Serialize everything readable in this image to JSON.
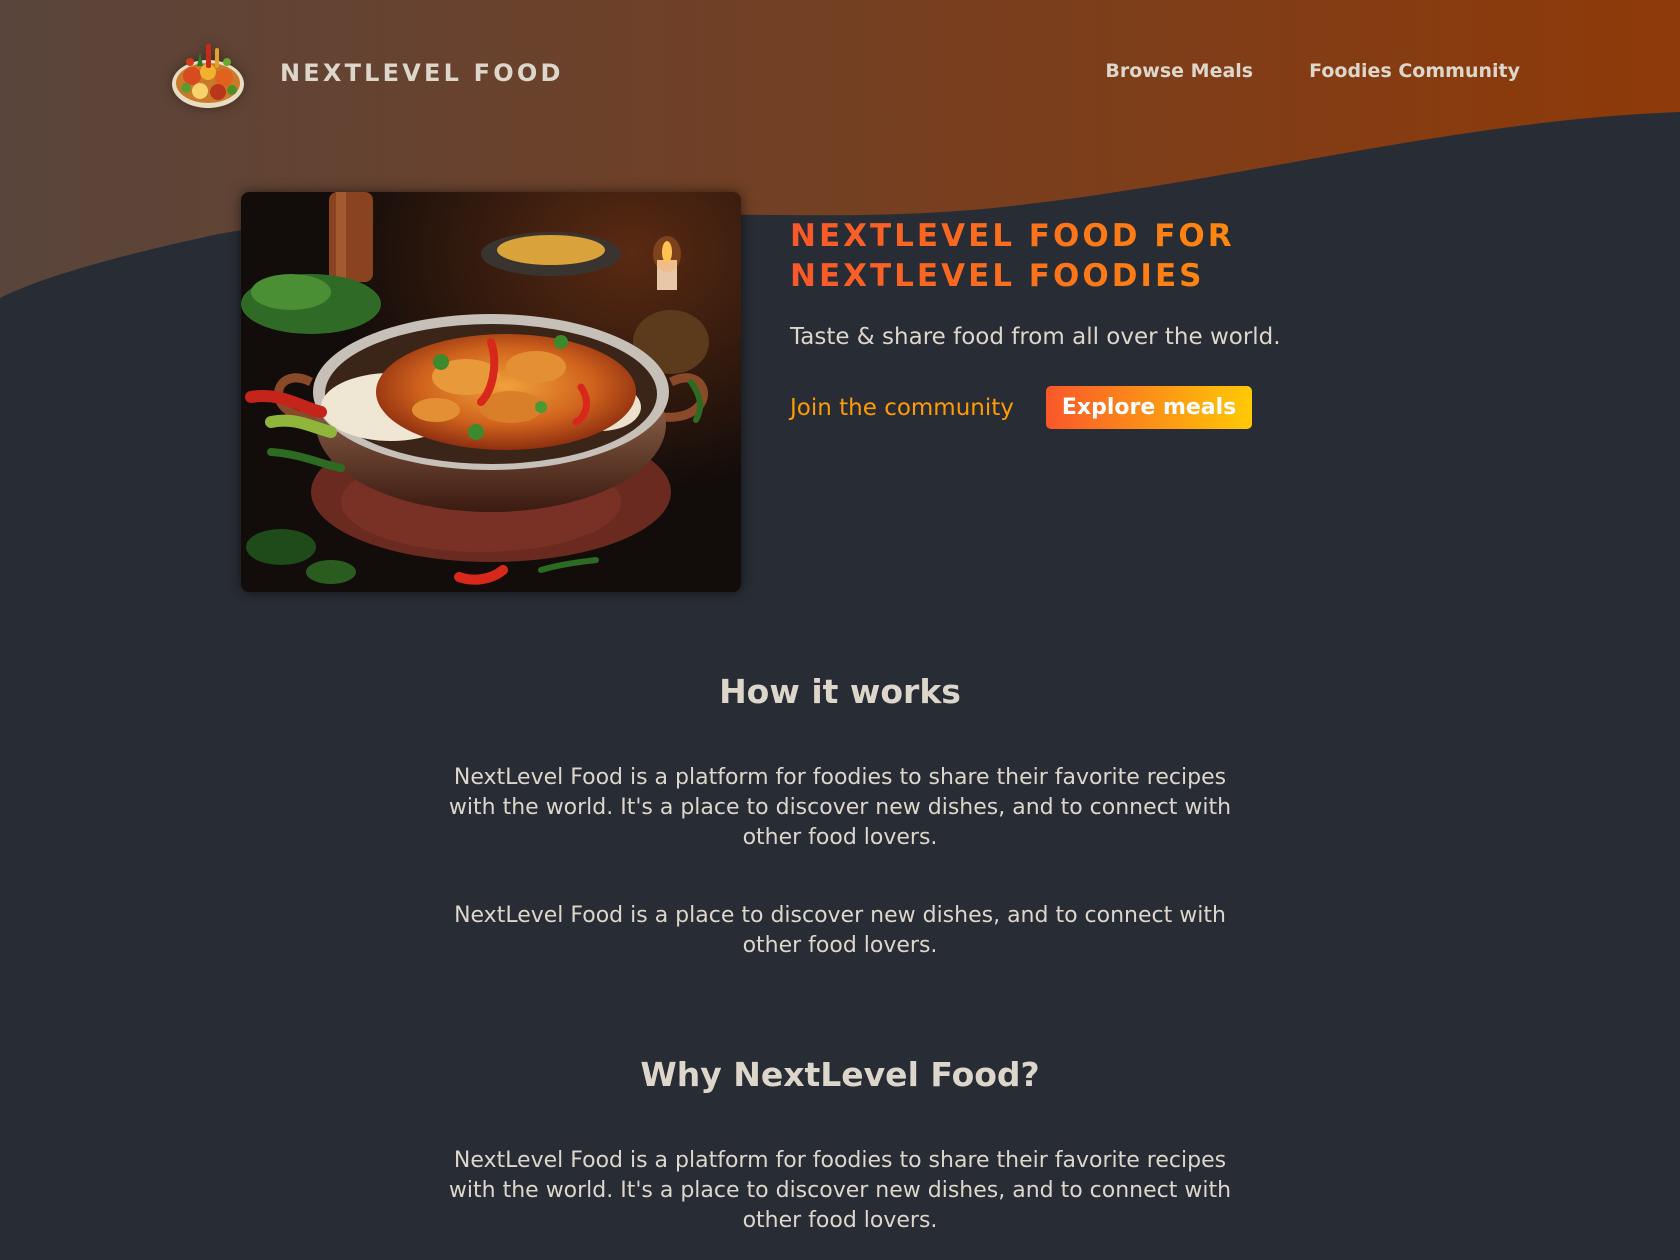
{
  "header": {
    "logo_alt": "A plate with food on it",
    "brand_name": "NextLevel Food",
    "nav": {
      "browse_meals": "Browse Meals",
      "foodies_community": "Foodies Community"
    }
  },
  "hero": {
    "image_alt": "A delicious, spicy curry",
    "title": "NextLevel Food for NextLevel Foodies",
    "subtitle": "Taste & share food from all over the world.",
    "join_link": "Join the community",
    "explore_button": "Explore meals"
  },
  "sections": {
    "how_it_works": {
      "heading": "How it works",
      "paragraph_1": "NextLevel Food is a platform for foodies to share their favorite recipes with the world. It's a place to discover new dishes, and to connect with other food lovers.",
      "paragraph_2": "NextLevel Food is a place to discover new dishes, and to connect with other food lovers."
    },
    "why": {
      "heading": "Why NextLevel Food?",
      "paragraph_1": "NextLevel Food is a platform for foodies to share their favorite recipes with the world. It's a place to discover new dishes, and to connect with other food lovers."
    }
  },
  "colors": {
    "page_background": "#282c34",
    "text": "#ddd6cb",
    "accent_orange": "#ff9b05",
    "accent_red_orange": "#f9572a",
    "header_gradient_start": "#59453c",
    "header_gradient_end": "#8f3a09"
  }
}
